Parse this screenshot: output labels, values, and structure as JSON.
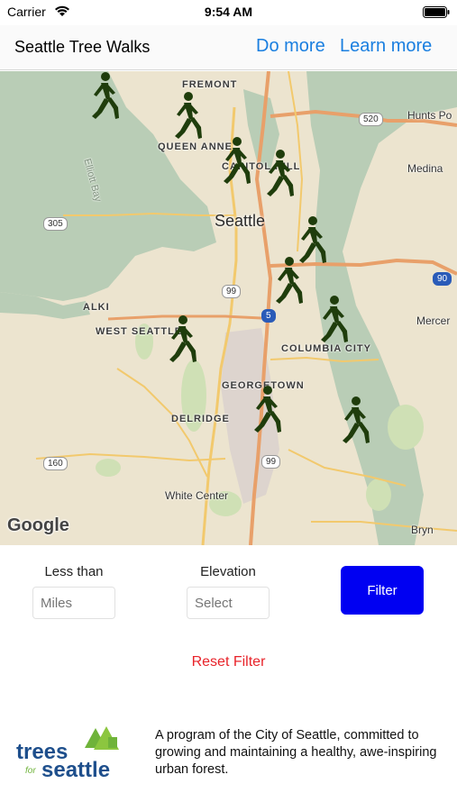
{
  "status_bar": {
    "carrier": "Carrier",
    "time": "9:54 AM"
  },
  "nav": {
    "title": "Seattle Tree Walks",
    "do_more": "Do more",
    "learn_more": "Learn more"
  },
  "map": {
    "neighborhoods": [
      "FREMONT",
      "QUEEN ANNE",
      "CAPITOL HILL",
      "ALKI",
      "WEST SEATTLE",
      "COLUMBIA CITY",
      "GEORGETOWN",
      "DELRIDGE"
    ],
    "city": "Seattle",
    "places": [
      "Hunts Po",
      "Medina",
      "Mercer",
      "White Center",
      "Bryn",
      "Elliott Bay"
    ],
    "shields": [
      "520",
      "305",
      "99",
      "5",
      "90",
      "99",
      "160"
    ],
    "attribution": "Google"
  },
  "filter": {
    "less_than_label": "Less than",
    "miles_placeholder": "Miles",
    "elevation_label": "Elevation",
    "elevation_placeholder": "Select",
    "filter_button": "Filter",
    "reset_label": "Reset Filter"
  },
  "footer": {
    "logo_line1": "trees",
    "logo_for": "for",
    "logo_line2": "seattle",
    "description": "A program of the City of Seattle, committed to growing and maintaining a healthy, awe-inspiring urban forest."
  },
  "colors": {
    "link": "#1a7fe0",
    "filter_button": "#0000f2",
    "reset": "#e8232a",
    "walker_marker": "#1f3d0c"
  }
}
